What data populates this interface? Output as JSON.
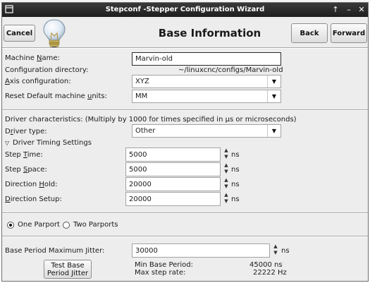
{
  "window": {
    "title": "Stepconf -Stepper Configuration Wizard",
    "controls": [
      "↑",
      "–",
      "✕"
    ]
  },
  "header": {
    "cancel": "Cancel",
    "title": "Base Information",
    "back": "Back",
    "forward": "Forward",
    "icon": "lightbulb-icon"
  },
  "machine": {
    "name_label": "Machine Name:",
    "name_value": "Marvin-old",
    "config_dir_label": "Configuration directory:",
    "config_dir_value": "~/linuxcnc/configs/Marvin-old",
    "axis_label": "Axis configuration:",
    "axis_value": "XYZ",
    "units_label": "Reset Default machine units:",
    "units_value": "MM"
  },
  "driver": {
    "characteristics": "Driver characteristics: (Multiply by 1000 for times specified in µs or microseconds)",
    "type_label": "Driver type:",
    "type_value": "Other",
    "timing_header": "Driver Timing Settings",
    "fields": [
      {
        "label": "Step Time:",
        "value": "5000",
        "unit": "ns"
      },
      {
        "label": "Step Space:",
        "value": "5000",
        "unit": "ns"
      },
      {
        "label": "Direction Hold:",
        "value": "20000",
        "unit": "ns"
      },
      {
        "label": "Direction Setup:",
        "value": "20000",
        "unit": "ns"
      }
    ]
  },
  "parport": {
    "one": "One Parport",
    "two": "Two Parports",
    "selected": "one"
  },
  "jitter": {
    "label": "Base Period Maximum Jitter:",
    "value": "30000",
    "unit": "ns",
    "test_button_line1": "Test Base",
    "test_button_line2": "Period Jitter",
    "min_period_label": "Min Base Period:",
    "min_period_value": "45000 ns",
    "max_rate_label": "Max step rate:",
    "max_rate_value": "22222 Hz"
  },
  "colors": {
    "titlebar": "#2a2a2a",
    "window_bg": "#ededed",
    "field_bg": "#ffffff"
  }
}
